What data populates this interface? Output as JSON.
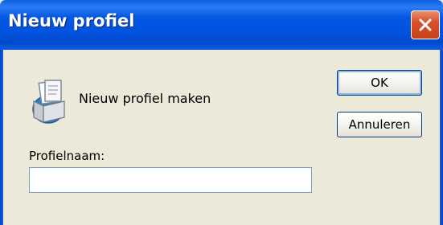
{
  "window": {
    "title": "Nieuw profiel",
    "close_icon": "close-icon"
  },
  "dialog": {
    "icon": "mail-profile-icon",
    "message": "Nieuw profiel maken",
    "ok_label": "OK",
    "cancel_label": "Annuleren",
    "field_label": "Profielnaam:",
    "field_value": ""
  },
  "colors": {
    "titlebar": "#0053e1",
    "close_button": "#d9512a",
    "window_body": "#ece9d8",
    "button_border": "#003c74",
    "input_border": "#7f9db9"
  }
}
